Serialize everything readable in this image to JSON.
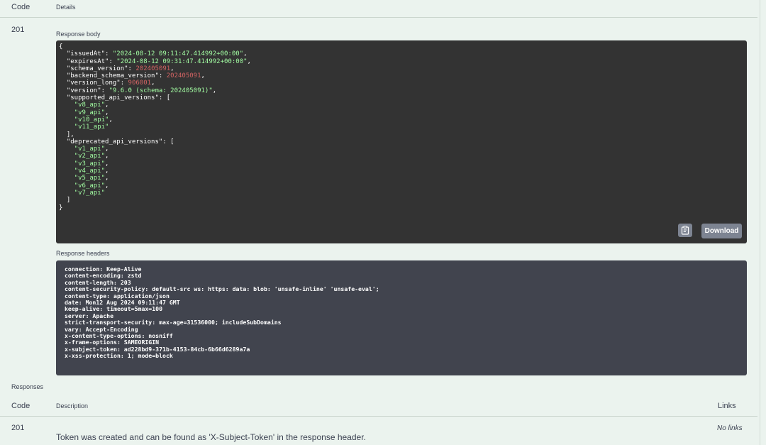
{
  "table_header": {
    "code": "Code",
    "details": "Details"
  },
  "response_row": {
    "code": "201",
    "body_label": "Response body",
    "body_json": "{\n  \"issuedAt\": \"2024-08-12 09:11:47.414992+00:00\",\n  \"expiresAt\": \"2024-08-12 09:31:47.414992+00:00\",\n  \"schema_version\": 202405091,\n  \"backend_schema_version\": 202405091,\n  \"version_long\": 906001,\n  \"version\": \"9.6.0 (schema: 202405091)\",\n  \"supported_api_versions\": [\n    \"v8_api\",\n    \"v9_api\",\n    \"v10_api\",\n    \"v11_api\"\n  ],\n  \"deprecated_api_versions\": [\n    \"v1_api\",\n    \"v2_api\",\n    \"v3_api\",\n    \"v4_api\",\n    \"v5_api\",\n    \"v6_api\",\n    \"v7_api\"\n  ]\n}",
    "copy_icon": "clipboard-icon",
    "download_label": "Download",
    "headers_label": "Response headers",
    "headers_text": "connection: Keep-Alive\ncontent-encoding: zstd\ncontent-length: 203\ncontent-security-policy: default-src ws: https: data: blob: 'unsafe-inline' 'unsafe-eval';\ncontent-type: application/json\ndate: Mon12 Aug 2024 09:11:47 GMT\nkeep-alive: timeout=5max=100\nserver: Apache\nstrict-transport-security: max-age=31536000; includeSubDomains\nvary: Accept-Encoding\nx-content-type-options: nosniff\nx-frame-options: SAMEORIGIN\nx-subject-token: ad228bd9-371b-4153-84cb-6b66d6289a7a\nx-xss-protection: 1; mode=block"
  },
  "responses": {
    "label": "Responses",
    "header": {
      "code": "Code",
      "description": "Description",
      "links": "Links"
    },
    "rows": [
      {
        "code": "201",
        "description": "Token was created and can be found as 'X-Subject-Token' in the response header.",
        "links": "No links"
      }
    ]
  },
  "colors": {
    "background": "#ebf3ee",
    "code_body_bg": "#333333",
    "code_headers_bg": "#41444e",
    "string": "#a2fca2",
    "number": "#d36363",
    "button": "#7d8492"
  }
}
